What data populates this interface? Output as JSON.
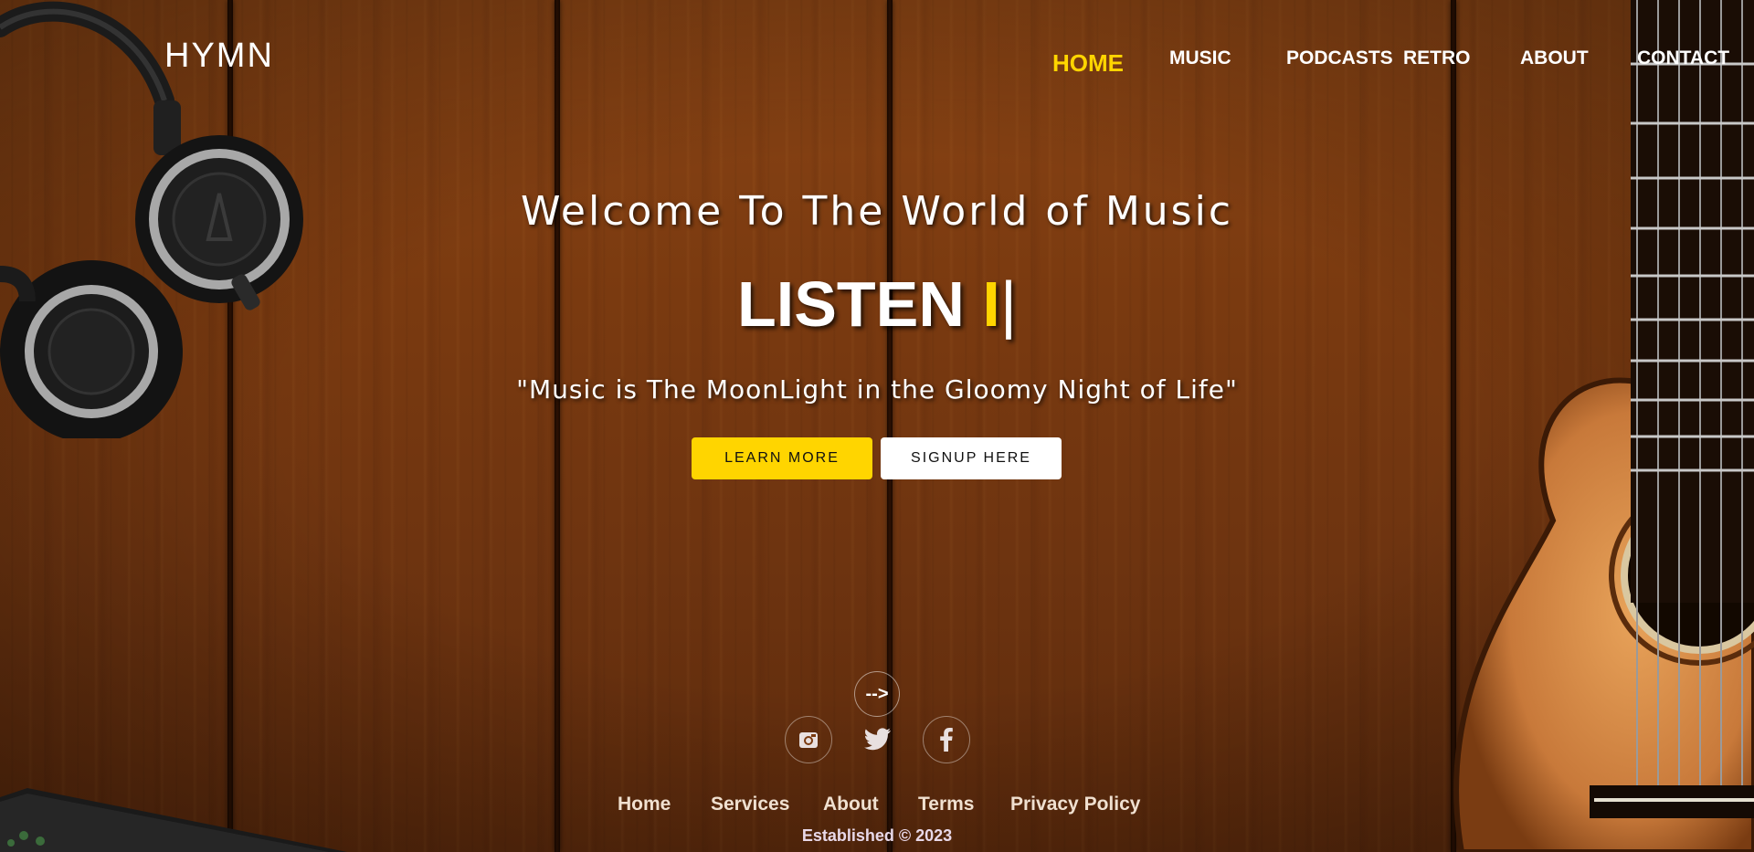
{
  "brand": "HYMN",
  "nav": {
    "home": "HOME",
    "music": "MUSIC",
    "podcasts": "PODCASTS",
    "retro": "RETRO",
    "about": "ABOUT",
    "contact": "CONTACT"
  },
  "hero": {
    "title": "Welcome To The World of Music",
    "listen_word": "LISTEN",
    "listen_accent": "I",
    "listen_caret": "|",
    "quote": "\"Music is The MoonLight in the Gloomy Night of Life\"",
    "learn_more": "LEARN MORE",
    "signup": "SIGNUP HERE"
  },
  "arrow": "-->",
  "social": {
    "icons": [
      "instagram-icon",
      "twitter-icon",
      "facebook-icon"
    ]
  },
  "footer": {
    "links": [
      "Home",
      "Services",
      "About",
      "Terms",
      "Privacy Policy"
    ],
    "established": "Established © 2023"
  },
  "colors": {
    "accent": "#ffd500",
    "wood": "#7a3a10",
    "text": "#ffffff"
  }
}
